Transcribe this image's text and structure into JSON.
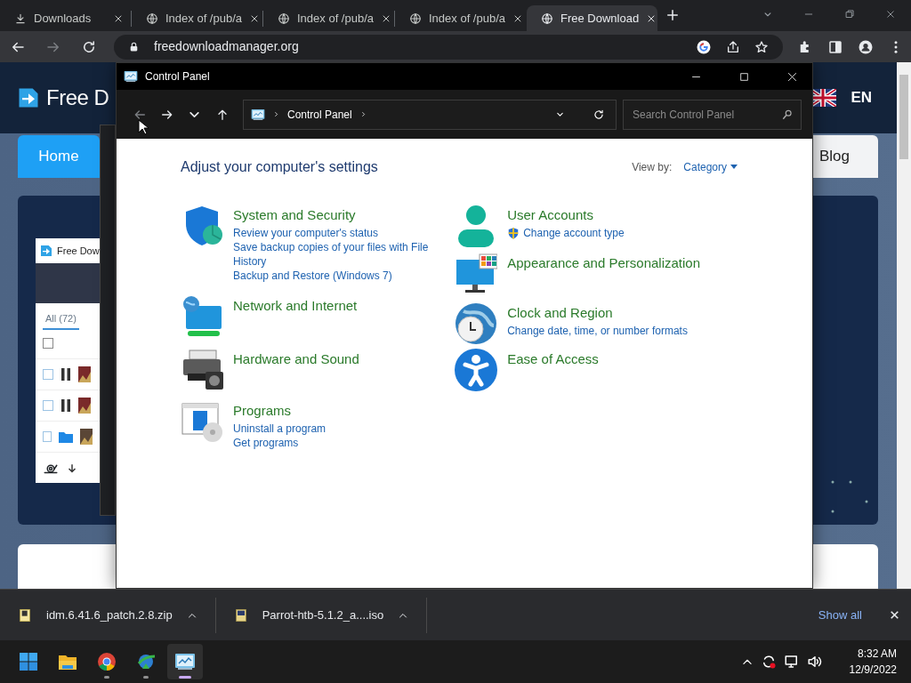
{
  "browser": {
    "tabs": [
      {
        "title": "Downloads",
        "kind": "download",
        "selected": false
      },
      {
        "title": "Index of /pub/a",
        "kind": "globe",
        "selected": false
      },
      {
        "title": "Index of /pub/a",
        "kind": "globe",
        "selected": false
      },
      {
        "title": "Index of /pub/a",
        "kind": "globe",
        "selected": false
      },
      {
        "title": "Free Download",
        "kind": "globe",
        "selected": true
      }
    ],
    "navigation": [
      {
        "kind": "back",
        "disabled": false
      },
      {
        "kind": "forward",
        "disabled": true
      },
      {
        "kind": "reload",
        "disabled": false
      }
    ],
    "address": "freedownloadmanager.org"
  },
  "webpage": {
    "logo_text": "Free D",
    "language": "EN",
    "nav": [
      {
        "label": "Home",
        "selected": true
      },
      {
        "label": "Blog",
        "selected": false
      }
    ],
    "app_preview": {
      "title": "Free Dow",
      "filter": "All (72)",
      "rows": [
        {
          "kind": "header",
          "checked": false
        },
        {
          "kind": "paused",
          "checked": false
        },
        {
          "kind": "paused",
          "checked": false
        },
        {
          "kind": "folder",
          "checked": false
        }
      ]
    }
  },
  "control_panel": {
    "title": "Control Panel",
    "navigation": [
      {
        "kind": "back",
        "disabled": true
      },
      {
        "kind": "forward",
        "disabled": false
      },
      {
        "kind": "recent",
        "disabled": false
      },
      {
        "kind": "up",
        "disabled": false
      }
    ],
    "breadcrumb": "Control Panel",
    "search_placeholder": "Search Control Panel",
    "heading": "Adjust your computer's settings",
    "view_by_label": "View by:",
    "view_by_value": "Category",
    "left_column": [
      {
        "title": "System and Security",
        "kind": "shield",
        "links": [
          {
            "text": "Review your computer's status",
            "shield": false
          },
          {
            "text": "Save backup copies of your files with File History",
            "shield": false
          },
          {
            "text": "Backup and Restore (Windows 7)",
            "shield": false
          }
        ]
      },
      {
        "title": "Network and Internet",
        "kind": "network"
      },
      {
        "title": "Hardware and Sound",
        "kind": "printer"
      },
      {
        "title": "Programs",
        "kind": "programs",
        "links": [
          {
            "text": "Uninstall a program",
            "shield": false
          },
          {
            "text": "Get programs",
            "shield": false
          }
        ]
      }
    ],
    "right_column": [
      {
        "title": "User Accounts",
        "kind": "user",
        "links": [
          {
            "text": "Change account type",
            "shield": true
          }
        ]
      },
      {
        "title": "Appearance and Personalization",
        "kind": "appearance"
      },
      {
        "title": "Clock and Region",
        "kind": "clock",
        "links": [
          {
            "text": "Change date, time, or number formats",
            "shield": false
          }
        ]
      },
      {
        "title": "Ease of Access",
        "kind": "ease"
      }
    ]
  },
  "downloads_bar": {
    "items": [
      {
        "name": "idm.6.41.6_patch.2.8.zip",
        "kind": "zip"
      },
      {
        "name": "Parrot-htb-5.1.2_a....iso",
        "kind": "iso"
      }
    ],
    "show_all": "Show all"
  },
  "taskbar": {
    "apps": [
      {
        "kind": "start",
        "running": false,
        "selected": false
      },
      {
        "kind": "folder",
        "running": false,
        "selected": false
      },
      {
        "kind": "chrome",
        "running": true,
        "selected": false
      },
      {
        "kind": "idm",
        "running": true,
        "selected": false
      },
      {
        "kind": "control",
        "running": true,
        "selected": true
      }
    ],
    "time": "8:32 AM",
    "date": "12/9/2022"
  }
}
